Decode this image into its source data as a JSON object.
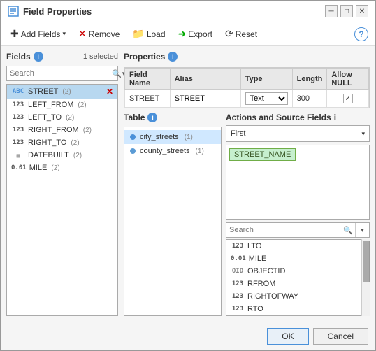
{
  "title": "Field Properties",
  "toolbar": {
    "add_fields": "Add Fields",
    "remove": "Remove",
    "load": "Load",
    "export": "Export",
    "reset": "Reset"
  },
  "left_panel": {
    "label": "Fields",
    "selected_count": "1 selected",
    "search_placeholder": "Search",
    "fields": [
      {
        "type": "ABC",
        "name": "STREET",
        "count": "(2)",
        "selected": true
      },
      {
        "type": "123",
        "name": "LEFT_FROM",
        "count": "(2)",
        "selected": false
      },
      {
        "type": "123",
        "name": "LEFT_TO",
        "count": "(2)",
        "selected": false
      },
      {
        "type": "123",
        "name": "RIGHT_FROM",
        "count": "(2)",
        "selected": false
      },
      {
        "type": "123",
        "name": "RIGHT_TO",
        "count": "(2)",
        "selected": false
      },
      {
        "type": "GRID",
        "name": "DATEBUILT",
        "count": "(2)",
        "selected": false
      },
      {
        "type": "0.01",
        "name": "MILE",
        "count": "(2)",
        "selected": false
      }
    ]
  },
  "properties": {
    "label": "Properties",
    "columns": [
      "Field Name",
      "Alias",
      "Type",
      "Length",
      "Allow NULL"
    ],
    "row": {
      "field_name": "STREET",
      "alias": "STREET",
      "type": "Text",
      "length": "300",
      "allow_null": true
    }
  },
  "table": {
    "label": "Table",
    "items": [
      {
        "name": "city_streets",
        "count": "(1)",
        "selected": true
      },
      {
        "name": "county_streets",
        "count": "(1)",
        "selected": false
      }
    ]
  },
  "actions": {
    "label": "Actions and Source Fields",
    "dropdown_value": "First",
    "source_chip": "STREET_NAME",
    "search_placeholder": "Search",
    "source_fields": [
      {
        "type": "123",
        "name": "LTO"
      },
      {
        "type": "0.01",
        "name": "MILE"
      },
      {
        "type": "OID",
        "name": "OBJECTID"
      },
      {
        "type": "123",
        "name": "RFROM"
      },
      {
        "type": "123",
        "name": "RIGHTOFWAY"
      },
      {
        "type": "123",
        "name": "RTO"
      }
    ]
  },
  "footer": {
    "ok": "OK",
    "cancel": "Cancel"
  }
}
